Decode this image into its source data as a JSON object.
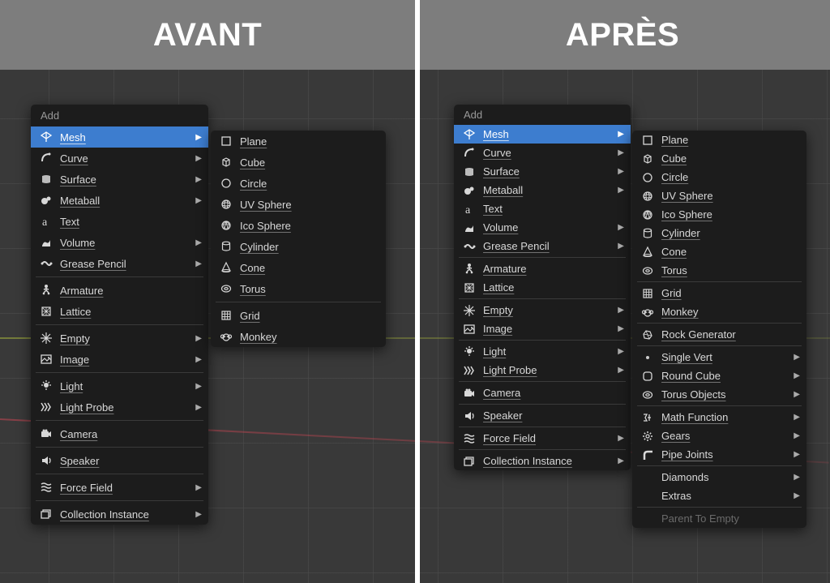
{
  "header": {
    "left": "AVANT",
    "right": "APRÈS"
  },
  "left": {
    "title": "Add",
    "items": [
      {
        "label": "Mesh",
        "icon": "mesh",
        "sub": true,
        "sel": true
      },
      {
        "label": "Curve",
        "icon": "curve",
        "sub": true
      },
      {
        "label": "Surface",
        "icon": "surface",
        "sub": true
      },
      {
        "label": "Metaball",
        "icon": "metaball",
        "sub": true
      },
      {
        "label": "Text",
        "icon": "text"
      },
      {
        "label": "Volume",
        "icon": "volume",
        "sub": true
      },
      {
        "label": "Grease Pencil",
        "icon": "gpencil",
        "sub": true
      },
      {
        "sep": true
      },
      {
        "label": "Armature",
        "icon": "armature"
      },
      {
        "label": "Lattice",
        "icon": "lattice"
      },
      {
        "sep": true
      },
      {
        "label": "Empty",
        "icon": "empty",
        "sub": true
      },
      {
        "label": "Image",
        "icon": "image",
        "sub": true
      },
      {
        "sep": true
      },
      {
        "label": "Light",
        "icon": "light",
        "sub": true
      },
      {
        "label": "Light Probe",
        "icon": "lightprobe",
        "sub": true
      },
      {
        "sep": true
      },
      {
        "label": "Camera",
        "icon": "camera"
      },
      {
        "sep": true
      },
      {
        "label": "Speaker",
        "icon": "speaker"
      },
      {
        "sep": true
      },
      {
        "label": "Force Field",
        "icon": "force",
        "sub": true
      },
      {
        "sep": true
      },
      {
        "label": "Collection Instance",
        "icon": "collection",
        "sub": true
      }
    ],
    "submenu": [
      {
        "label": "Plane",
        "icon": "plane"
      },
      {
        "label": "Cube",
        "icon": "cube"
      },
      {
        "label": "Circle",
        "icon": "circle"
      },
      {
        "label": "UV Sphere",
        "icon": "uvsphere"
      },
      {
        "label": "Ico Sphere",
        "icon": "icosphere"
      },
      {
        "label": "Cylinder",
        "icon": "cylinder"
      },
      {
        "label": "Cone",
        "icon": "cone"
      },
      {
        "label": "Torus",
        "icon": "torus"
      },
      {
        "sep": true
      },
      {
        "label": "Grid",
        "icon": "grid"
      },
      {
        "label": "Monkey",
        "icon": "monkey"
      }
    ]
  },
  "right": {
    "title": "Add",
    "items": [
      {
        "label": "Mesh",
        "icon": "mesh",
        "sub": true,
        "sel": true
      },
      {
        "label": "Curve",
        "icon": "curve",
        "sub": true
      },
      {
        "label": "Surface",
        "icon": "surface",
        "sub": true
      },
      {
        "label": "Metaball",
        "icon": "metaball",
        "sub": true
      },
      {
        "label": "Text",
        "icon": "text"
      },
      {
        "label": "Volume",
        "icon": "volume",
        "sub": true
      },
      {
        "label": "Grease Pencil",
        "icon": "gpencil",
        "sub": true
      },
      {
        "sep": true
      },
      {
        "label": "Armature",
        "icon": "armature"
      },
      {
        "label": "Lattice",
        "icon": "lattice"
      },
      {
        "sep": true
      },
      {
        "label": "Empty",
        "icon": "empty",
        "sub": true
      },
      {
        "label": "Image",
        "icon": "image",
        "sub": true
      },
      {
        "sep": true
      },
      {
        "label": "Light",
        "icon": "light",
        "sub": true
      },
      {
        "label": "Light Probe",
        "icon": "lightprobe",
        "sub": true
      },
      {
        "sep": true
      },
      {
        "label": "Camera",
        "icon": "camera"
      },
      {
        "sep": true
      },
      {
        "label": "Speaker",
        "icon": "speaker"
      },
      {
        "sep": true
      },
      {
        "label": "Force Field",
        "icon": "force",
        "sub": true
      },
      {
        "sep": true
      },
      {
        "label": "Collection Instance",
        "icon": "collection",
        "sub": true
      }
    ],
    "submenu": [
      {
        "label": "Plane",
        "icon": "plane"
      },
      {
        "label": "Cube",
        "icon": "cube"
      },
      {
        "label": "Circle",
        "icon": "circle"
      },
      {
        "label": "UV Sphere",
        "icon": "uvsphere"
      },
      {
        "label": "Ico Sphere",
        "icon": "icosphere"
      },
      {
        "label": "Cylinder",
        "icon": "cylinder"
      },
      {
        "label": "Cone",
        "icon": "cone"
      },
      {
        "label": "Torus",
        "icon": "torus"
      },
      {
        "sep": true
      },
      {
        "label": "Grid",
        "icon": "grid"
      },
      {
        "label": "Monkey",
        "icon": "monkey"
      },
      {
        "sep": true
      },
      {
        "label": "Rock Generator",
        "icon": "rock"
      },
      {
        "sep": true
      },
      {
        "label": "Single Vert",
        "icon": "dot",
        "sub": true
      },
      {
        "label": "Round Cube",
        "icon": "roundcube",
        "sub": true
      },
      {
        "label": "Torus Objects",
        "icon": "torus",
        "sub": true
      },
      {
        "sep": true
      },
      {
        "label": "Math Function",
        "icon": "math",
        "sub": true
      },
      {
        "label": "Gears",
        "icon": "gear",
        "sub": true
      },
      {
        "label": "Pipe Joints",
        "icon": "pipe",
        "sub": true
      },
      {
        "sep": true
      },
      {
        "label": "Diamonds",
        "icon": "",
        "sub": true,
        "noul": true
      },
      {
        "label": "Extras",
        "icon": "",
        "sub": true,
        "noul": true
      },
      {
        "sep": true
      },
      {
        "label": "Parent To Empty",
        "icon": "",
        "disabled": true,
        "noul": true
      }
    ]
  }
}
